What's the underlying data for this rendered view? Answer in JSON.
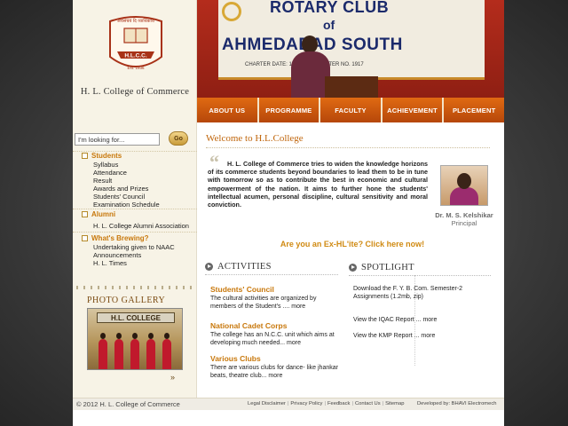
{
  "header": {
    "college_name": "H. L. College of Commerce",
    "crest": {
      "motto": "अर्थसंचयं दि व्याधिकारी",
      "initials": "H.L.C.C.",
      "est": "Est. 1936"
    },
    "banner": {
      "line1": "ROTARY CLUB",
      "line2": "of",
      "line3": "AHMEDABAD SOUTH",
      "line4": "CHARTER DATE: 12 JAN ... CHARTER NO. 1917"
    }
  },
  "nav": {
    "items": [
      {
        "label": "ABOUT US"
      },
      {
        "label": "PROGRAMME"
      },
      {
        "label": "FACULTY"
      },
      {
        "label": "ACHIEVEMENT"
      },
      {
        "label": "PLACEMENT"
      }
    ]
  },
  "search": {
    "value": "I'm looking for...",
    "go_label": "Go"
  },
  "sidebar": {
    "students": {
      "title": "Students",
      "links": [
        "Syllabus",
        "Attendance",
        "Result",
        "Awards and Prizes",
        "Students' Council",
        "Examination Schedule"
      ]
    },
    "alumni": {
      "title": "Alumni",
      "links": [
        "H. L. College Alumni  Association"
      ]
    },
    "brewing": {
      "title": "What's Brewing?",
      "links": [
        "Undertaking given to NAAC",
        "Announcements",
        "H. L. Times"
      ]
    },
    "gallery": {
      "title": "PHOTO GALLERY",
      "photo_sign": "H.L. COLLEGE",
      "next": "»"
    }
  },
  "main": {
    "welcome": "Welcome to H.L.College",
    "quote_mark": "“",
    "intro": "H. L. College of Commerce tries to widen the knowledge horizons of its commerce students beyond boundaries to lead them to be in tune with tomorrow so as to contribute the best in economic and cultural empowerment of the nation. It aims to further hone the students' intellectual acumen, personal discipline, cultural sensitivity and moral conviction.",
    "principal_name": "Dr. M. S. Kelshikar",
    "principal_title": "Principal",
    "exhl_link": "Are you an Ex-HL'ite? Click here now!",
    "activities": {
      "heading": "ACTIVITIES",
      "items": [
        {
          "title": "Students' Council",
          "text": "The cultural activities are organized by members of the Student's ....",
          "more": "more"
        },
        {
          "title": "National Cadet Corps",
          "text": "The college has an N.C.C. unit which aims at developing much needed...",
          "more": "more"
        },
        {
          "title": "Various Clubs",
          "text": "There are various clubs for dance- like jhankar beats, theatre club...",
          "more": "more"
        }
      ]
    },
    "spotlight": {
      "heading": "SPOTLIGHT",
      "items": [
        "Download the F. Y. B. Com. Semester-2 Assignments (1.2mb, zip)",
        "View the IQAC Report ... more",
        "View the KMP Report ... more"
      ]
    }
  },
  "footer": {
    "copyright": "© 2012 H. L. College of Commerce",
    "links": [
      "Legal Disclaimer",
      "Privacy Policy",
      "Feedback",
      "Contact Us",
      "Sitemap"
    ],
    "developer": "Developed by: BHAVI Electromech"
  },
  "colors": {
    "accent_orange": "#c8780c",
    "nav_orange": "#e06a12",
    "sidebar_bg": "#f7f3e6"
  }
}
